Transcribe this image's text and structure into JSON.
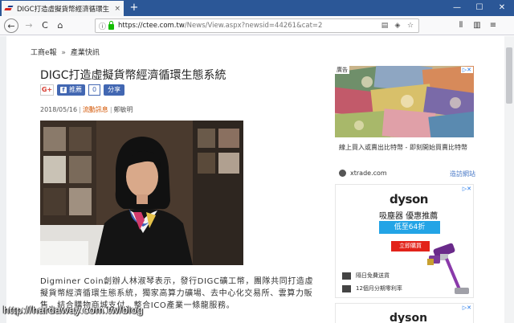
{
  "browser": {
    "tab_title": "DIGC打造虛擬貨幣經濟循環生",
    "tab_close": "×",
    "new_tab": "+",
    "minimize": "—",
    "maximize": "☐",
    "close": "✕",
    "url_host": "https://ctee.com.tw",
    "url_path": "/News/View.aspx?newsid=44261&cat=2",
    "back": "←",
    "forward": "→",
    "reload": "C",
    "home": "⌂"
  },
  "breadcrumb": {
    "home": "工商e報",
    "sep": "»",
    "section": "產業快訊"
  },
  "article": {
    "headline": "DIGC打造虛擬貨幣經濟循環生態系統",
    "date": "2018/05/16",
    "category": "流動訊息",
    "author": "鄭敏明",
    "body": "Digminer Coin創辦人林淑琴表示，發行DIGC礦工幣，團隊共同打造虛擬貨幣經濟循環生態系統，獨家高算力礦場、去中心化交易所、雲算力販售、結合購物商城支付、整合ICO產業一條龍服務。"
  },
  "share": {
    "gplus": "G+",
    "fb_like": "推薦",
    "fb_count": "0",
    "fb_share": "分享"
  },
  "ads": {
    "ad1_tag": "廣告",
    "ad1_caption": "線上買入或賣出比特幣 - 即刻開始買賣比特幣",
    "source": "xtrade.com",
    "visit": "造訪網站",
    "dyson_logo": "dyson",
    "dyson_promo": "吸塵器 優惠推薦",
    "dyson_price": "低至64折",
    "dyson_cta": "立即購買",
    "dyson_row1": "隔日免費送貨",
    "dyson_row2": "12個月分期零利率"
  },
  "watermark": "http://hardaway.com.tw/blog",
  "colors": {
    "titlebar": "#2b5797",
    "accent": "#d35400",
    "fb": "#4267b2",
    "dyson_blue": "#23a4e6",
    "dyson_red": "#e2231a"
  }
}
